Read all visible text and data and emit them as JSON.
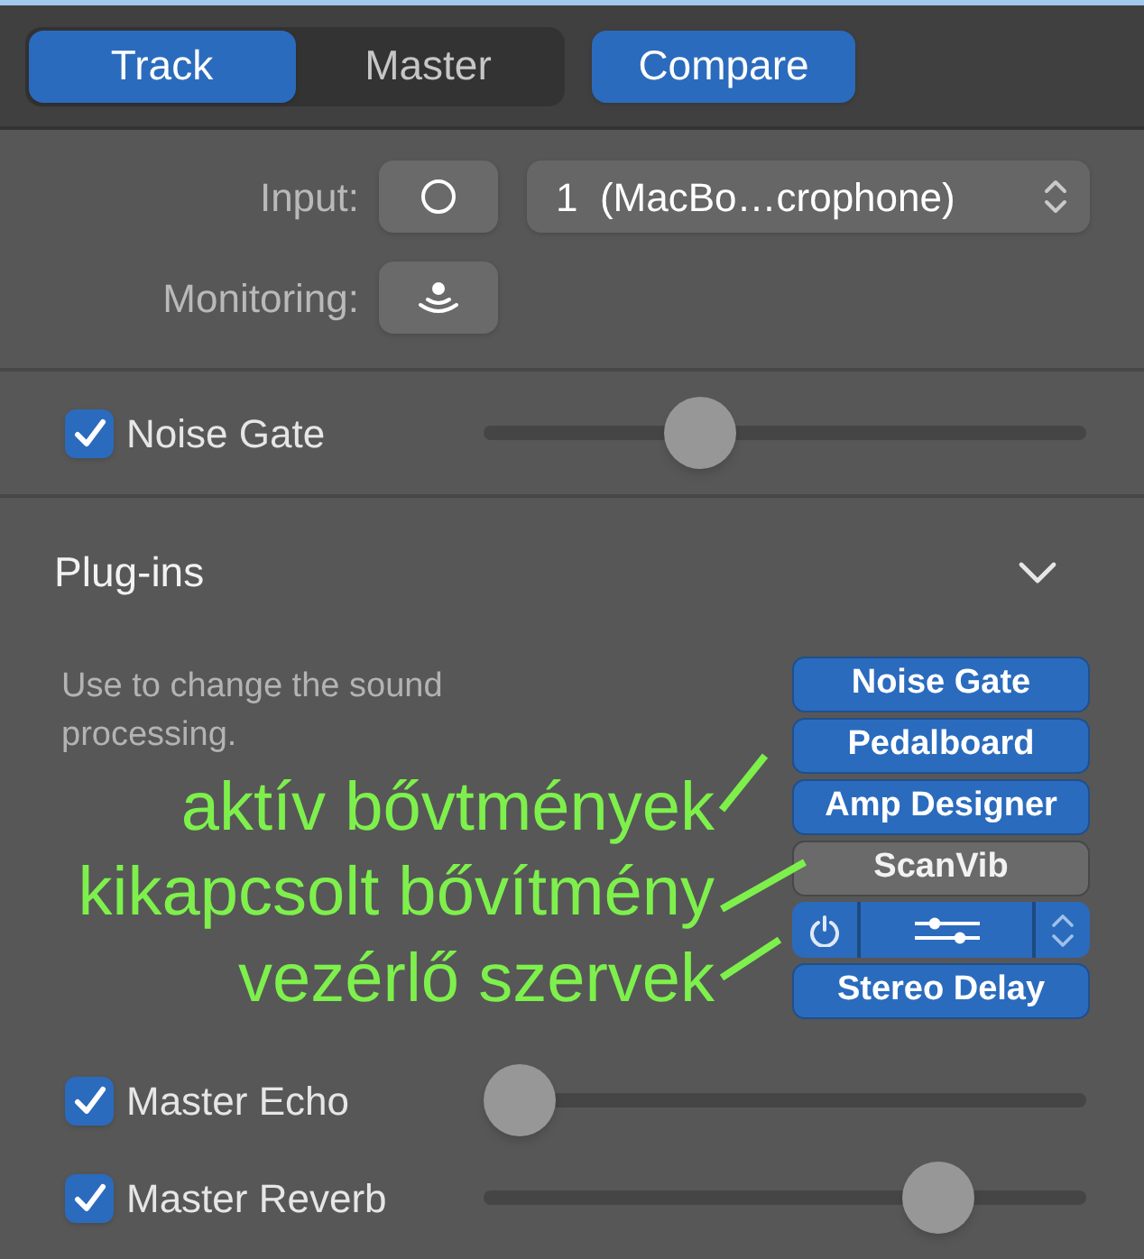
{
  "top_bar": {
    "tabs": [
      {
        "label": "Track",
        "selected": true
      },
      {
        "label": "Master",
        "selected": false
      }
    ],
    "compare_button": {
      "label": "Compare"
    }
  },
  "input": {
    "label": "Input:",
    "device": "1  (MacBo…crophone)"
  },
  "monitoring": {
    "label": "Monitoring:"
  },
  "noise_gate": {
    "label": "Noise Gate",
    "checked": true,
    "level": 0.34
  },
  "plugins": {
    "title": "Plug-ins",
    "expanded": true,
    "description": "Use to change the sound processing.",
    "slots": [
      {
        "kind": "plugin",
        "name": "Noise Gate",
        "on": true
      },
      {
        "kind": "plugin",
        "name": "Pedalboard",
        "on": true
      },
      {
        "kind": "plugin",
        "name": "Amp Designer",
        "on": true
      },
      {
        "kind": "plugin",
        "name": "ScanVib",
        "on": false
      },
      {
        "kind": "controls"
      },
      {
        "kind": "plugin",
        "name": "Stereo Delay",
        "on": true
      }
    ]
  },
  "annotations": [
    "aktív bővtmények",
    "kikapcsolt bővítmény",
    "vezérlő szervek"
  ],
  "master_effects": [
    {
      "label": "Master Echo",
      "checked": true,
      "level": 0
    },
    {
      "label": "Master Reverb",
      "checked": true,
      "level": 0.79
    }
  ]
}
